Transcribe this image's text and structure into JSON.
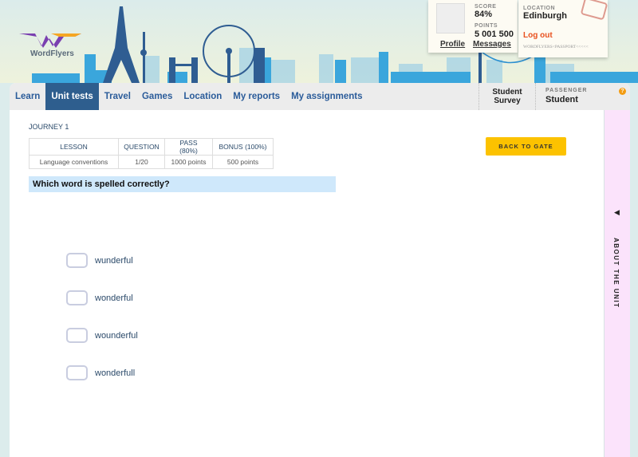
{
  "logo": {
    "name": "WordFlyers"
  },
  "profile": {
    "score_label": "SCORE",
    "score": "84%",
    "points_label": "POINTS",
    "points": "5 001 500",
    "profile_link": "Profile",
    "messages_link": "Messages"
  },
  "location": {
    "label": "LOCATION",
    "value": "Edinburgh",
    "logout": "Log out",
    "passport_code": "WORDFLYERS<PASSPORT<<<<<"
  },
  "nav": {
    "tabs": [
      {
        "label": "Learn"
      },
      {
        "label": "Unit tests"
      },
      {
        "label": "Travel"
      },
      {
        "label": "Games"
      },
      {
        "label": "Location"
      },
      {
        "label": "My reports"
      },
      {
        "label": "My assignments"
      }
    ],
    "survey": "Student Survey",
    "passenger_label": "PASSENGER",
    "passenger": "Student",
    "help": "?"
  },
  "journey": "JOURNEY 1",
  "table": {
    "headers": [
      "LESSON",
      "QUESTION",
      "PASS (80%)",
      "BONUS (100%)"
    ],
    "row": [
      "Language conventions",
      "1/20",
      "1000 points",
      "500 points"
    ]
  },
  "question": "Which word is spelled correctly?",
  "back_button": "BACK TO GATE",
  "options": [
    "wunderful",
    "wonderful",
    "wounderful",
    "wonderfull"
  ],
  "sidebar": {
    "label": "ABOUT THE UNIT",
    "arrow": "◀"
  }
}
